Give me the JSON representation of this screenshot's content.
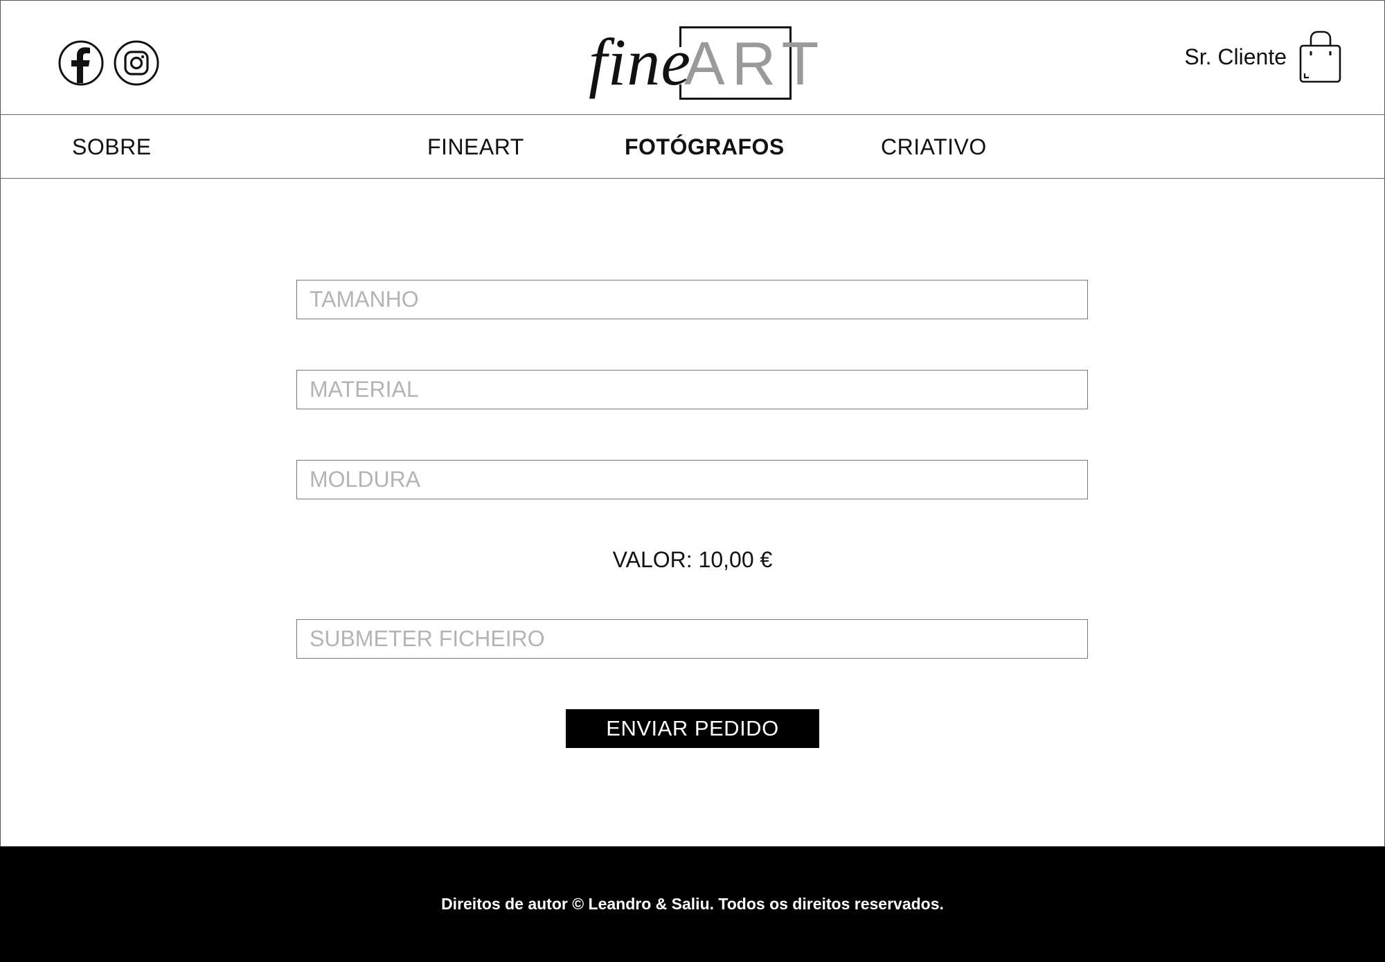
{
  "header": {
    "logo": {
      "script": "fine",
      "box": "ART"
    },
    "user_name": "Sr. Cliente"
  },
  "social": [
    {
      "icon": "facebook-icon"
    },
    {
      "icon": "instagram-icon"
    }
  ],
  "nav": {
    "items": [
      {
        "label": "SOBRE",
        "active": false
      },
      {
        "label": "FINEART",
        "active": false
      },
      {
        "label": "FOTÓGRAFOS",
        "active": true
      },
      {
        "label": "CRIATIVO",
        "active": false
      }
    ]
  },
  "form": {
    "tamanho_placeholder": "TAMANHO",
    "material_placeholder": "MATERIAL",
    "moldura_placeholder": "MOLDURA",
    "valor": "VALOR: 10,00 €",
    "ficheiro_placeholder": "SUBMETER FICHEIRO",
    "submit_label": "ENVIAR PEDIDO"
  },
  "footer": {
    "copyright": "Direitos de autor © Leandro & Saliu. Todos os direitos reservados."
  },
  "colors": {
    "primary": "#000000",
    "placeholder": "#b4b4b4",
    "logo_art": "#9a9a9a"
  }
}
